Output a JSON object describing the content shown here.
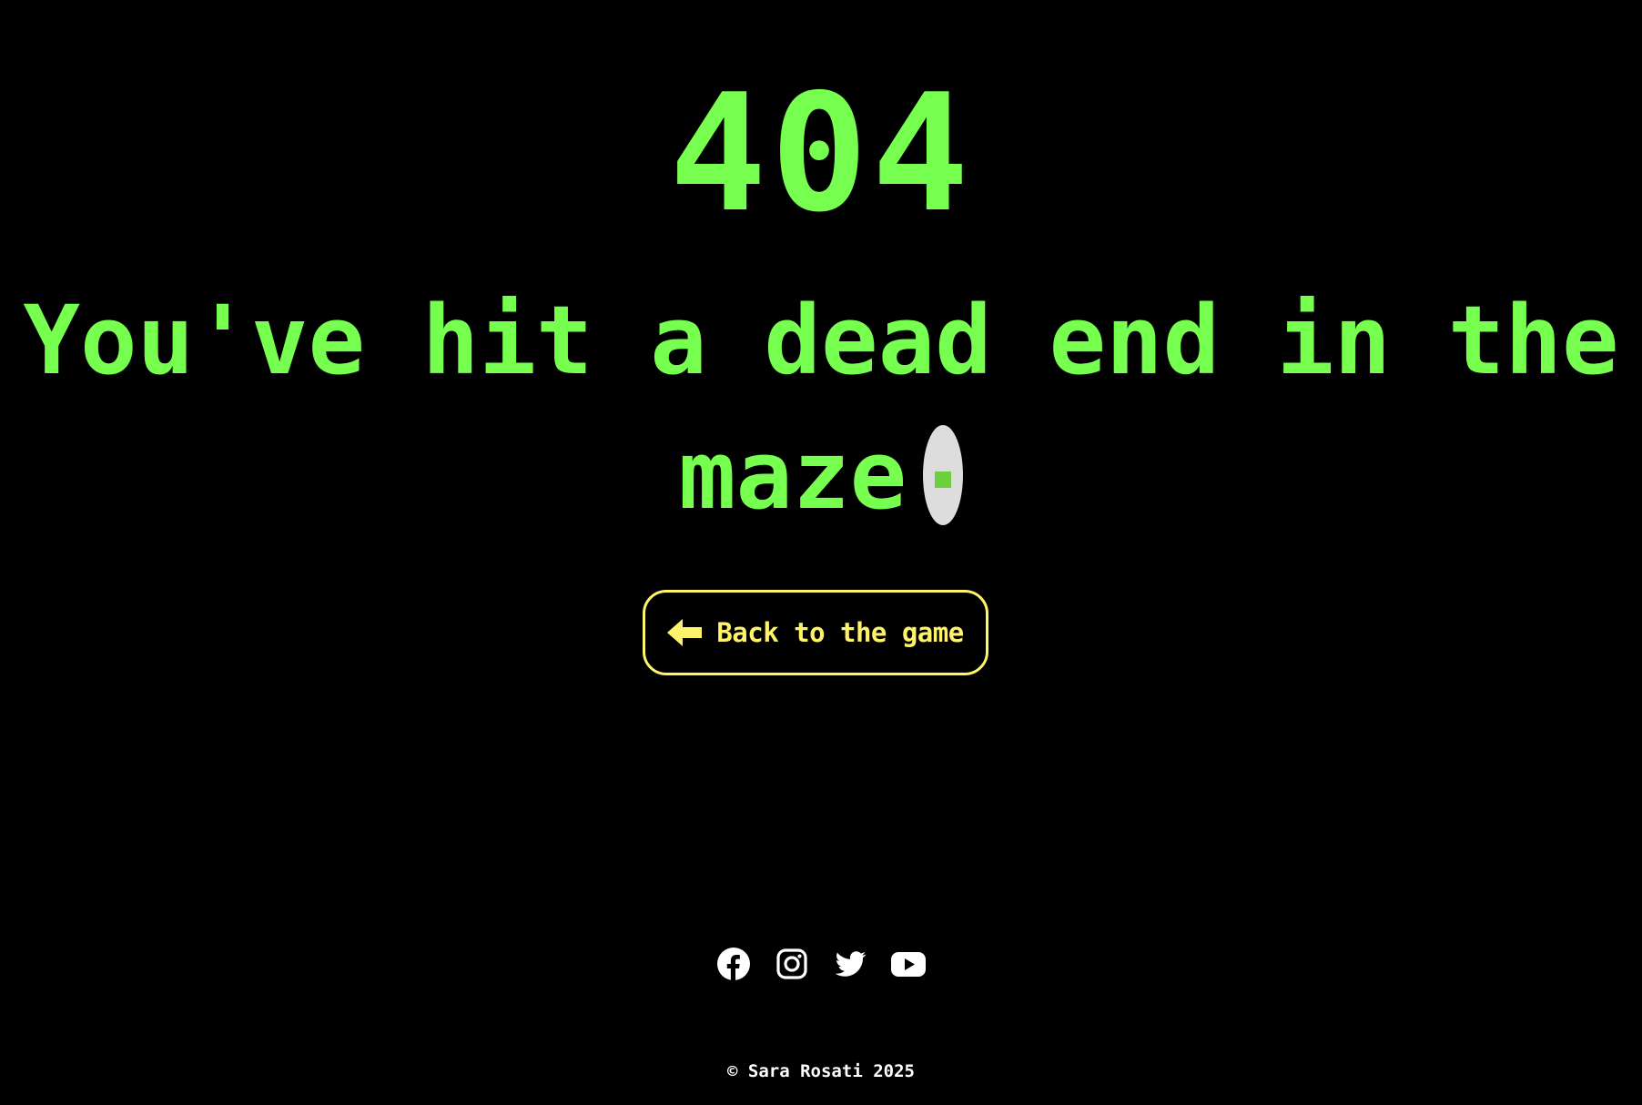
{
  "error": {
    "code": "404",
    "message_line1": "You've hit a dead end in the",
    "message_line2": "maze"
  },
  "back_button": {
    "label": "Back to the game",
    "icon": "arrow-left-icon"
  },
  "social_links": [
    {
      "name": "facebook",
      "icon": "facebook-icon"
    },
    {
      "name": "instagram",
      "icon": "instagram-icon"
    },
    {
      "name": "twitter",
      "icon": "twitter-icon"
    },
    {
      "name": "youtube",
      "icon": "youtube-icon"
    }
  ],
  "footer": {
    "copyright": "© Sara Rosati 2025"
  },
  "colors": {
    "background": "#000000",
    "primary_green": "#77ff50",
    "button_yellow": "#fff36a",
    "pac_grey": "#dddddd",
    "text_white": "#ffffff"
  }
}
